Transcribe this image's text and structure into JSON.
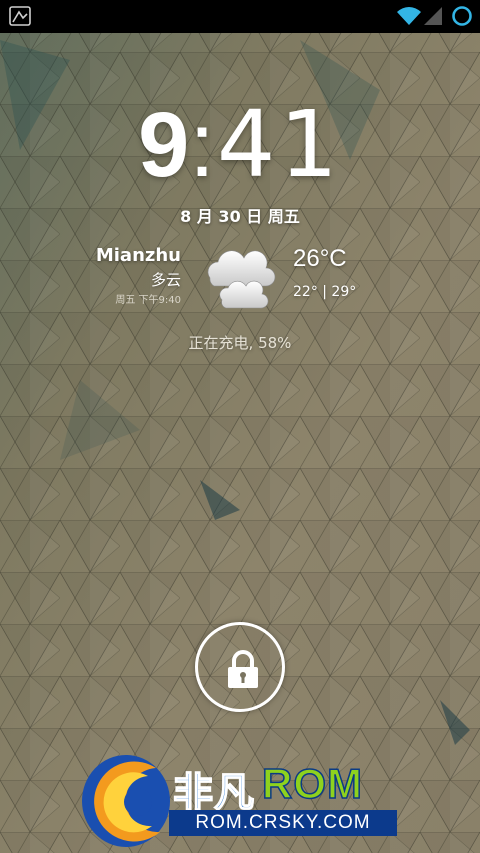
{
  "clock": {
    "hour": "9",
    "separator": ":",
    "minutes": "41"
  },
  "date": "8 月 30 日 周五",
  "weather": {
    "city": "Mianzhu",
    "condition": "多云",
    "updated": "周五 下午9:40",
    "temperature": "26°C",
    "range": "22° | 29°",
    "icon": "cloudy-icon"
  },
  "charging_status": "正在充电, 58%",
  "watermark": {
    "brand_cn": "非凡",
    "brand_rom": "ROM",
    "url": "ROM.CRSKY.COM"
  },
  "colors": {
    "wallpaper": "#8a8169",
    "status_bar": "#000000",
    "wifi": "#33b5e5",
    "watermark_blue": "#1e6fd0",
    "watermark_green": "#8ed21e"
  }
}
